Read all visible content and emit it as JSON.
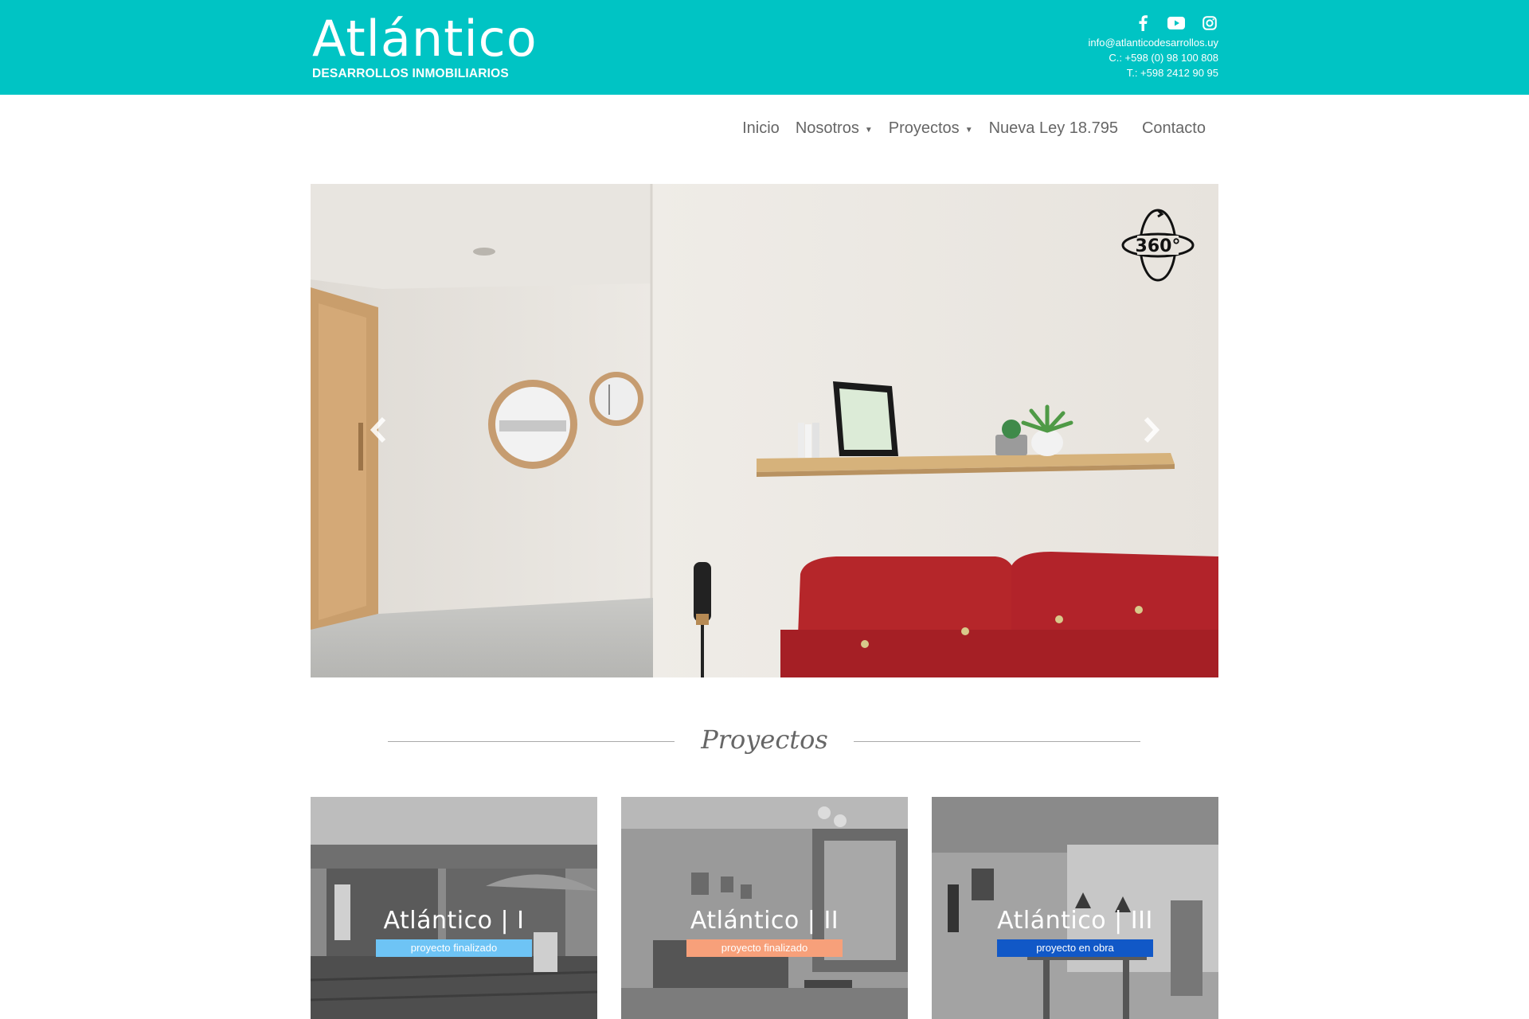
{
  "header": {
    "logo_title": "Atlántico",
    "logo_subtitle": "DESARROLLOS INMOBILIARIOS",
    "social_icons": [
      "facebook-icon",
      "youtube-icon",
      "instagram-icon"
    ],
    "email": "info@atlanticodesarrollos.uy",
    "cell": "C.: +598 (0) 98 100 808",
    "phone": "T.: +598 2412 90 95",
    "bar_color": "#00c4c4"
  },
  "nav": {
    "items": [
      {
        "label": "Inicio"
      },
      {
        "label": "Nosotros",
        "dropdown": true
      },
      {
        "label": "Proyectos",
        "dropdown": true
      },
      {
        "label": "Nueva Ley 18.795"
      },
      {
        "label": "Contacto"
      }
    ]
  },
  "hero": {
    "badge": "360°",
    "prev_icon": "chevron-left-icon",
    "next_icon": "chevron-right-icon"
  },
  "projects": {
    "title": "Proyectos",
    "cards": [
      {
        "name": "Atlántico",
        "numeral": "I",
        "status": "proyecto finalizado",
        "status_color": "#6ec4f5"
      },
      {
        "name": "Atlántico",
        "numeral": "II",
        "status": "proyecto finalizado",
        "status_color": "#f7a07a"
      },
      {
        "name": "Atlántico",
        "numeral": "III",
        "status": "proyecto en obra",
        "status_color": "#1158c7"
      }
    ]
  }
}
